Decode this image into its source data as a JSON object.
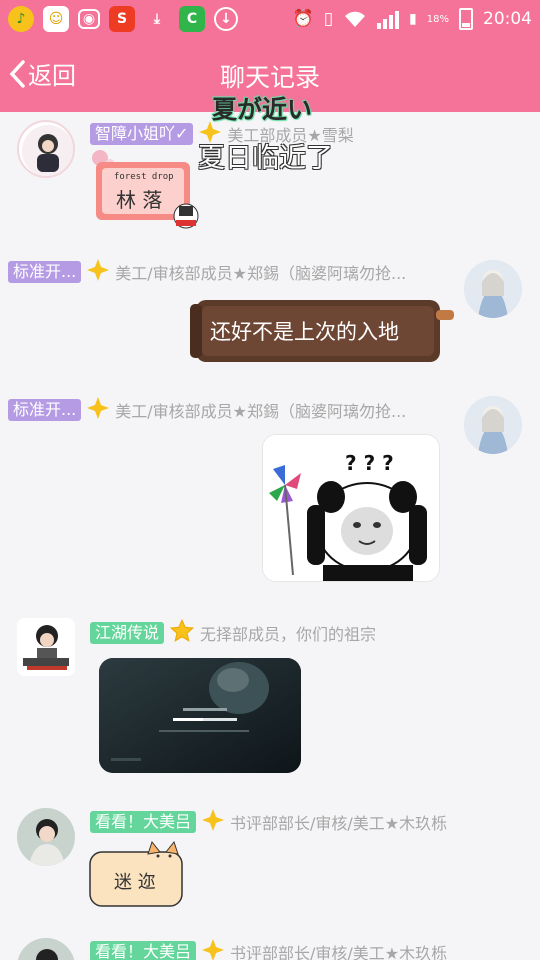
{
  "status_bar": {
    "battery_percent": "18%",
    "time": "20:04",
    "icons": [
      "music-app-icon",
      "face-app-icon",
      "screenshot-icon",
      "sogou-icon",
      "download-icon",
      "green-app-icon",
      "download-circle-icon",
      "alarm-icon",
      "vibrate-icon",
      "wifi-icon",
      "signal-icon",
      "sim-icon",
      "battery-icon"
    ]
  },
  "header": {
    "back_label": "返回",
    "title": "聊天记录"
  },
  "overlay": {
    "line1": "夏が近い",
    "line2": "夏日临近了"
  },
  "messages": [
    {
      "side": "left",
      "badge": "智障小姐吖✓",
      "badge_color": "#b59be3",
      "role": "美工部成员★雪梨",
      "sticker_text_top": "forest drop",
      "sticker_text_main": "林 落"
    },
    {
      "side": "right",
      "badge": "标准开...",
      "badge_color": "#b59be3",
      "role": "美工/审核部成员★郑錫（脑婆阿璃勿抢...",
      "text": "还好不是上次的入地"
    },
    {
      "side": "right",
      "badge": "标准开...",
      "badge_color": "#b59be3",
      "role": "美工/审核部成员★郑錫（脑婆阿璃勿抢...",
      "image_text": "? ? ?"
    },
    {
      "side": "left",
      "badge": "江湖传说",
      "badge_color": "#65d69b",
      "role": "无择部成员，你们的祖宗"
    },
    {
      "side": "left",
      "badge": "看看！大美吕",
      "badge_color": "#65d69b",
      "role": "书评部部长/审核/美工★木玖栎",
      "sticker_text": "迷 迩"
    },
    {
      "side": "left",
      "badge": "看看！大美吕",
      "badge_color": "#65d69b",
      "role": "书评部部长/审核/美工★木玖栎"
    }
  ]
}
